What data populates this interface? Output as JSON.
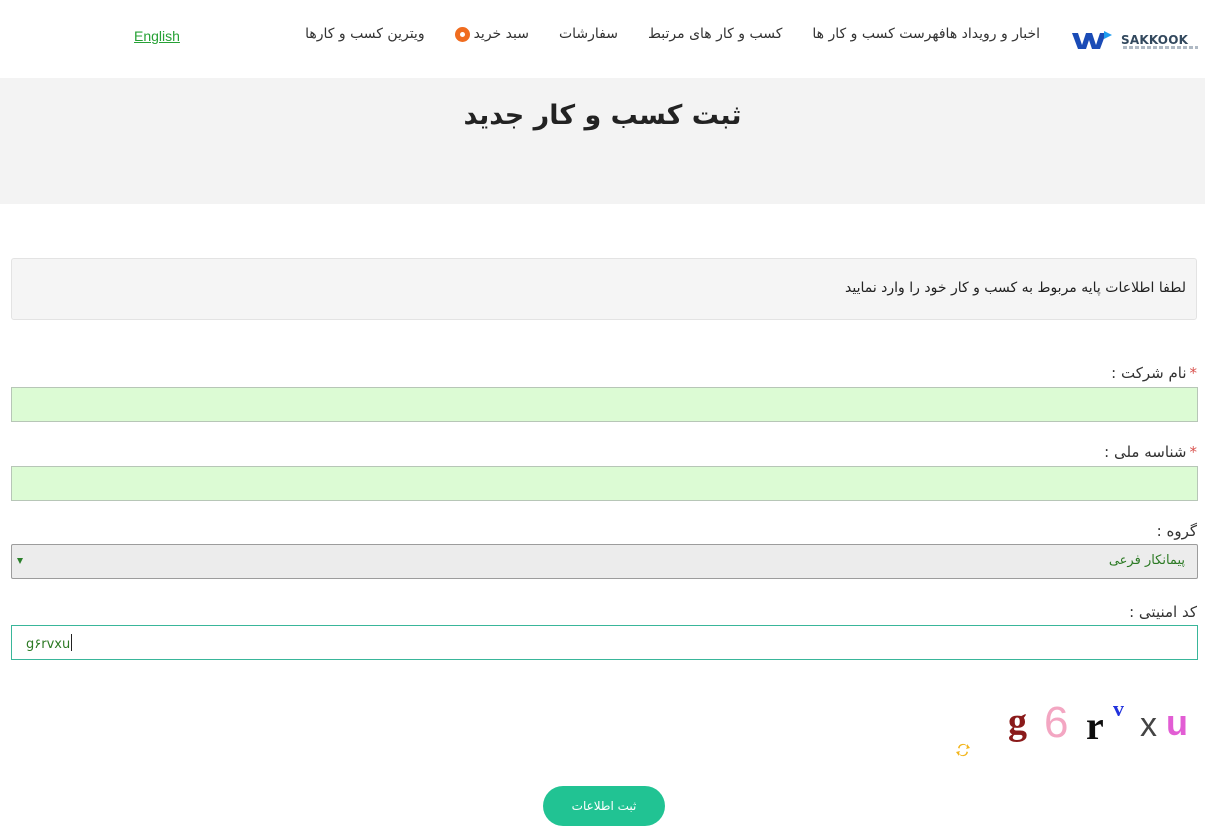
{
  "brand": {
    "logo_text": "SAKKOOK",
    "logo_icon": "sakkook-logo-icon"
  },
  "nav": {
    "items": [
      {
        "label": "ویترین کسب و کارها"
      },
      {
        "label": "سبد خرید"
      },
      {
        "label": "سفارشات"
      },
      {
        "label": "کسب و کار های مرتبط"
      },
      {
        "label": "فهرست کسب و کار ها"
      },
      {
        "label": "اخبار و رویداد ها"
      }
    ],
    "language": "English",
    "cart_icon": "cart-badge-icon"
  },
  "page": {
    "title": "ثبت کسب و کار جدید"
  },
  "info": {
    "text": "لطفا اطلاعات پایه مربوط به کسب و کار خود را وارد نمایید"
  },
  "form": {
    "company_name": {
      "label": "نام شرکت :",
      "required_mark": "*",
      "value": ""
    },
    "national_id": {
      "label": "شناسه ملی :",
      "required_mark": "*",
      "value": ""
    },
    "group": {
      "label": "گروه :",
      "selected": "پیمانکار فرعی"
    },
    "security_code": {
      "label": "کد امنیتی :",
      "value": "g۶rvxu"
    },
    "captcha": {
      "chars": [
        "g",
        "6",
        "r",
        "v",
        "x",
        "u"
      ],
      "refresh_icon": "refresh-icon"
    },
    "submit_label": "ثبت اطلاعات"
  },
  "colors": {
    "accent": "#21c393",
    "language_link": "#26a135",
    "input_bg": "#dcfbd4",
    "hero_bg": "#f3f3f3",
    "cart_badge": "#f06c1f"
  }
}
